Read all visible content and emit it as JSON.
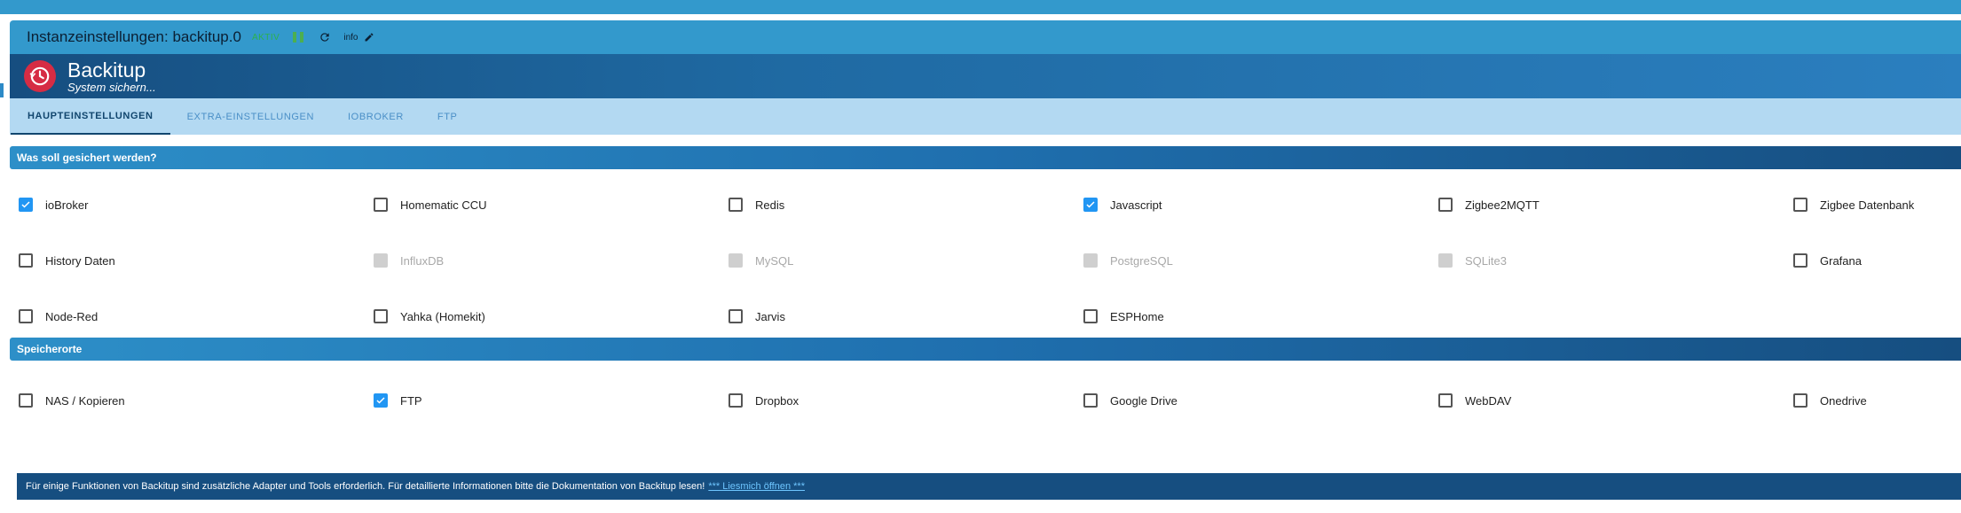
{
  "titlebar": {
    "title": "Instanzeinstellungen: backitup.0",
    "status": "AKTIV",
    "info_label": "info"
  },
  "header": {
    "name": "Backitup",
    "slogan": "System sichern..."
  },
  "tabs": [
    {
      "label": "HAUPTEINSTELLUNGEN",
      "active": true
    },
    {
      "label": "EXTRA-EINSTELLUNGEN",
      "active": false
    },
    {
      "label": "IOBROKER",
      "active": false
    },
    {
      "label": "FTP",
      "active": false
    }
  ],
  "section_backup": {
    "title": "Was soll gesichert werden?",
    "items": [
      {
        "label": "ioBroker",
        "checked": true,
        "disabled": false
      },
      {
        "label": "Homematic CCU",
        "checked": false,
        "disabled": false
      },
      {
        "label": "Redis",
        "checked": false,
        "disabled": false
      },
      {
        "label": "Javascript",
        "checked": true,
        "disabled": false
      },
      {
        "label": "Zigbee2MQTT",
        "checked": false,
        "disabled": false
      },
      {
        "label": "Zigbee Datenbank",
        "checked": false,
        "disabled": false
      },
      {
        "label": "History Daten",
        "checked": false,
        "disabled": false
      },
      {
        "label": "InfluxDB",
        "checked": false,
        "disabled": true
      },
      {
        "label": "MySQL",
        "checked": false,
        "disabled": true
      },
      {
        "label": "PostgreSQL",
        "checked": false,
        "disabled": true
      },
      {
        "label": "SQLite3",
        "checked": false,
        "disabled": true
      },
      {
        "label": "Grafana",
        "checked": false,
        "disabled": false
      },
      {
        "label": "Node-Red",
        "checked": false,
        "disabled": false
      },
      {
        "label": "Yahka (Homekit)",
        "checked": false,
        "disabled": false
      },
      {
        "label": "Jarvis",
        "checked": false,
        "disabled": false
      },
      {
        "label": "ESPHome",
        "checked": false,
        "disabled": false
      }
    ]
  },
  "section_storage": {
    "title": "Speicherorte",
    "items": [
      {
        "label": "NAS / Kopieren",
        "checked": false,
        "disabled": false
      },
      {
        "label": "FTP",
        "checked": true,
        "disabled": false
      },
      {
        "label": "Dropbox",
        "checked": false,
        "disabled": false
      },
      {
        "label": "Google Drive",
        "checked": false,
        "disabled": false
      },
      {
        "label": "WebDAV",
        "checked": false,
        "disabled": false
      },
      {
        "label": "Onedrive",
        "checked": false,
        "disabled": false
      }
    ]
  },
  "footer": {
    "text": "Für einige Funktionen von Backitup sind zusätzliche Adapter und Tools erforderlich. Für detaillierte Informationen bitte die Dokumentation von Backitup lesen!",
    "link": "*** Liesmich öffnen ***"
  },
  "colors": {
    "accent": "#3399cc",
    "header_dark": "#164e80",
    "tab_bg": "#b3d9f2",
    "checkbox_checked": "#2196f3",
    "logo": "#d62c44"
  }
}
